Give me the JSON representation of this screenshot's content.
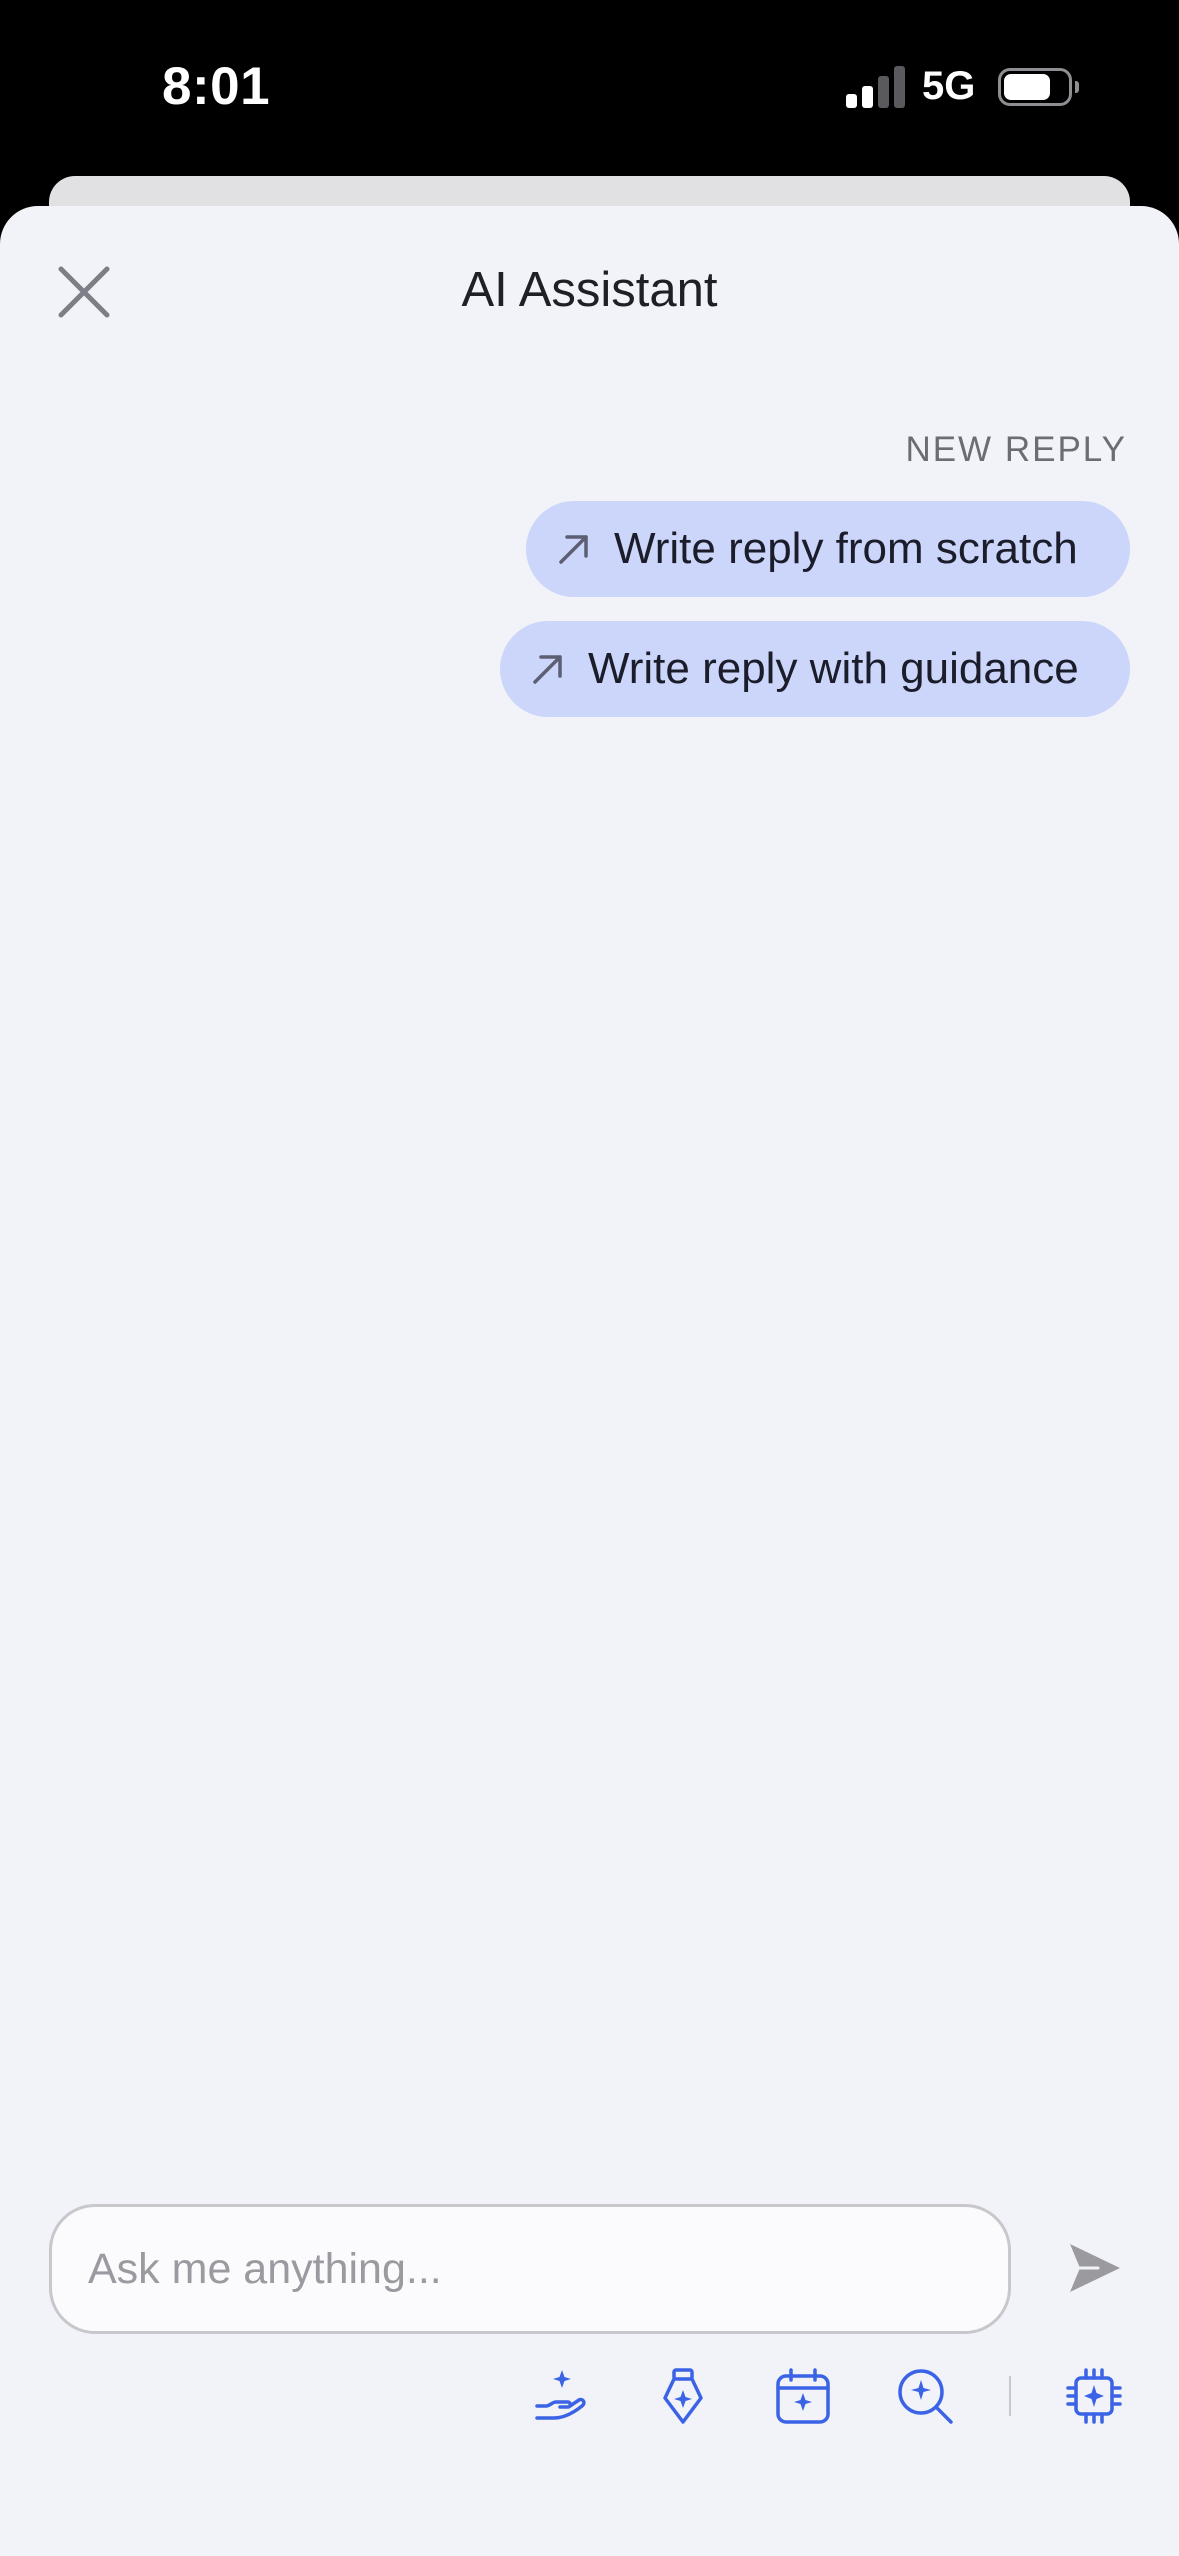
{
  "status_bar": {
    "time": "8:01",
    "network": "5G",
    "signal_bars_active": 2,
    "signal_bars_total": 4,
    "battery_level": 0.8
  },
  "header": {
    "title": "AI Assistant",
    "close_icon": "close-icon"
  },
  "suggestions": {
    "section_label": "NEW REPLY",
    "items": [
      {
        "label": "Write reply from scratch",
        "icon": "arrow-up-right-icon"
      },
      {
        "label": "Write reply with guidance",
        "icon": "arrow-up-right-icon"
      }
    ]
  },
  "composer": {
    "placeholder": "Ask me anything...",
    "value": "",
    "send_icon": "send-icon"
  },
  "toolbar": {
    "tools": [
      "hand-sparkle-icon",
      "pen-sparkle-icon",
      "calendar-sparkle-icon",
      "search-sparkle-icon",
      "chip-sparkle-icon"
    ]
  },
  "colors": {
    "sheet_background": "#f2f3f8",
    "pill_background": "#ccd6fb",
    "accent_blue": "#3a63e6",
    "text_primary": "#1f2026",
    "text_muted": "#6c6d73",
    "send_disabled": "#9a9a9f"
  }
}
